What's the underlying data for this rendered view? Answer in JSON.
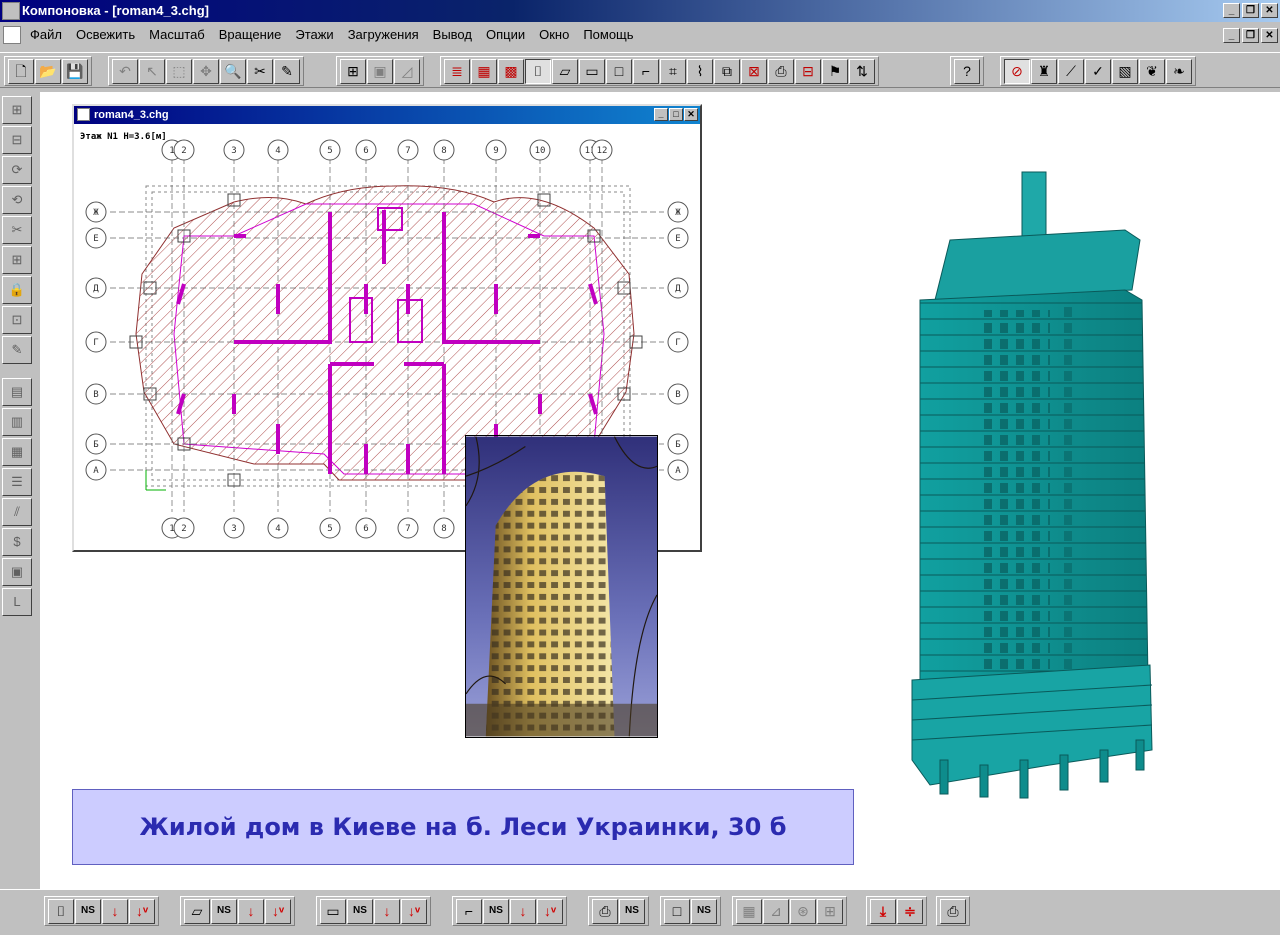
{
  "window": {
    "title": "Компоновка - [roman4_3.chg]",
    "buttons": [
      "_",
      "❐",
      "✕"
    ]
  },
  "menubar": {
    "items": [
      "Файл",
      "Освежить",
      "Масштаб",
      "Вращение",
      "Этажи",
      "Загружения",
      "Вывод",
      "Опции",
      "Окно",
      "Помощь"
    ],
    "doc_buttons": [
      "_",
      "❐",
      "✕"
    ]
  },
  "toolbar": {
    "icons": [
      "new-file-icon",
      "open-folder-icon",
      "save-icon",
      "undo-icon",
      "select-icon",
      "select-area-icon",
      "move-icon",
      "zoom-icon",
      "tools-icon",
      "pencil-icon",
      "grid-icon",
      "frame-icon",
      "plot-icon",
      "layers-icon",
      "table-icon",
      "table2-icon",
      "column-icon",
      "wall-icon",
      "slab-icon",
      "beam-icon",
      "stair-icon",
      "load-icon",
      "copy-icon",
      "delete-icon",
      "print-icon",
      "ruler-icon",
      "flag-icon",
      "sort-icon",
      "help-icon",
      "stop-icon",
      "building-icon",
      "crane-icon",
      "check-icon",
      "brick-icon",
      "leaf-icon",
      "leaf2-icon"
    ]
  },
  "plan_window": {
    "title": "roman4_3.chg",
    "floor_label": "Этаж N1  H=3.6[м]",
    "axes_top": [
      "1",
      "2",
      "3",
      "4",
      "5",
      "6",
      "7",
      "8",
      "9",
      "10",
      "11",
      "12"
    ],
    "axes_bottom": [
      "1",
      "2",
      "3",
      "4",
      "5",
      "6",
      "7",
      "8"
    ],
    "axes_left": [
      "Ж",
      "Е",
      "Д",
      "Г",
      "В",
      "Б",
      "А"
    ],
    "axes_right": [
      "Ж",
      "Е",
      "Д",
      "Г",
      "В",
      "Б",
      "А"
    ]
  },
  "caption": {
    "text": "Жилой дом в Киеве на б. Леси Украинки, 30 б"
  },
  "bottombar": {
    "ns_label": "NS"
  },
  "colors": {
    "caption_bg": "#ccccff",
    "caption_text": "#2b2bb0",
    "model_teal": "#1fa0a0",
    "hatch": "#a04040",
    "walls": "#c000c0"
  }
}
